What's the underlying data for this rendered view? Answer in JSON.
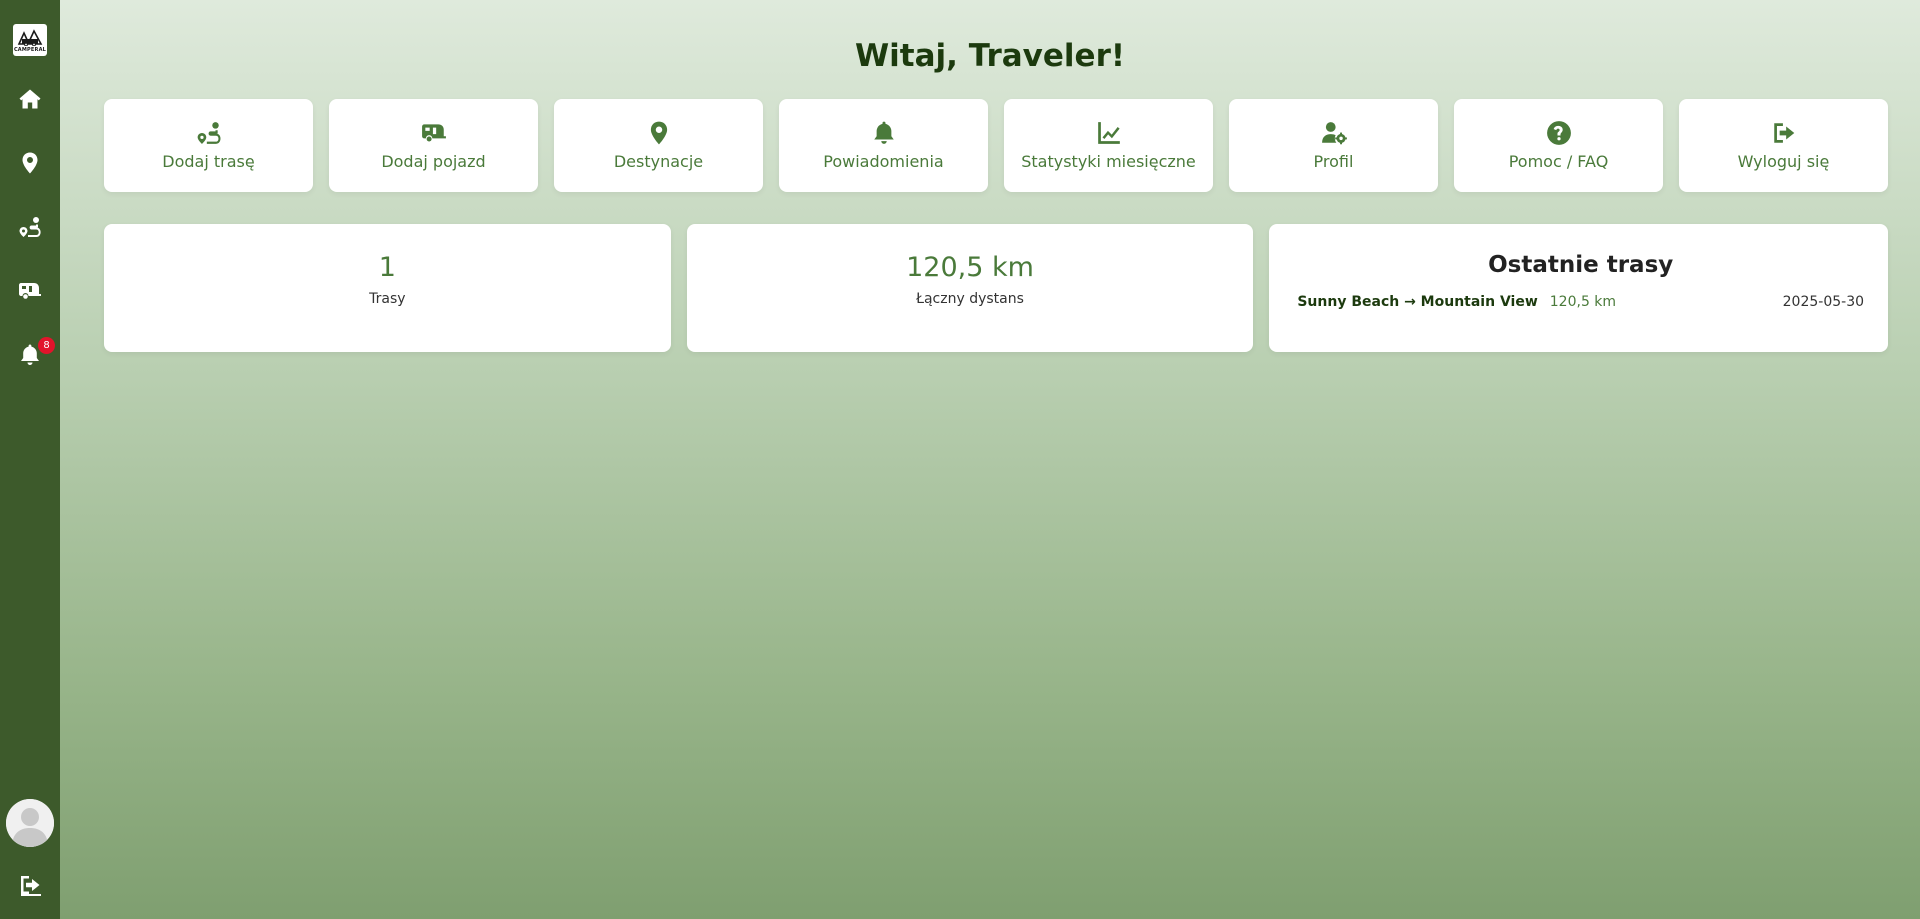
{
  "app": {
    "logo_text": "CAMPERAL"
  },
  "sidebar": {
    "items": [
      {
        "name": "home",
        "icon": "home-icon"
      },
      {
        "name": "destinations",
        "icon": "map-pin-icon"
      },
      {
        "name": "routes",
        "icon": "route-icon"
      },
      {
        "name": "vehicles",
        "icon": "caravan-icon"
      },
      {
        "name": "notifications",
        "icon": "bell-icon",
        "badge": "8"
      }
    ],
    "badge_color": "#e2142b",
    "bottom": [
      {
        "name": "profile",
        "icon": "avatar-icon"
      },
      {
        "name": "logout",
        "icon": "logout-icon"
      }
    ]
  },
  "header": {
    "welcome": "Witaj, Traveler!"
  },
  "actions": [
    {
      "label": "Dodaj trasę",
      "icon": "route-icon"
    },
    {
      "label": "Dodaj pojazd",
      "icon": "caravan-icon"
    },
    {
      "label": "Destynacje",
      "icon": "map-pin-icon"
    },
    {
      "label": "Powiadomienia",
      "icon": "bell-icon"
    },
    {
      "label": "Statystyki miesięczne",
      "icon": "chart-line-icon"
    },
    {
      "label": "Profil",
      "icon": "user-gear-icon"
    },
    {
      "label": "Pomoc / FAQ",
      "icon": "question-circle-icon"
    },
    {
      "label": "Wyloguj się",
      "icon": "logout-icon"
    }
  ],
  "stats": {
    "routes": {
      "value": "1",
      "label": "Trasy"
    },
    "distance": {
      "value": "120,5 km",
      "label": "Łączny dystans"
    }
  },
  "recent": {
    "title": "Ostatnie trasy",
    "items": [
      {
        "route": "Sunny Beach → Mountain View",
        "distance": "120,5 km",
        "date": "2025-05-30"
      }
    ]
  },
  "colors": {
    "sidebar": "#3d5a2b",
    "accent": "#4a7a3a",
    "heading": "#1c3a0e"
  }
}
